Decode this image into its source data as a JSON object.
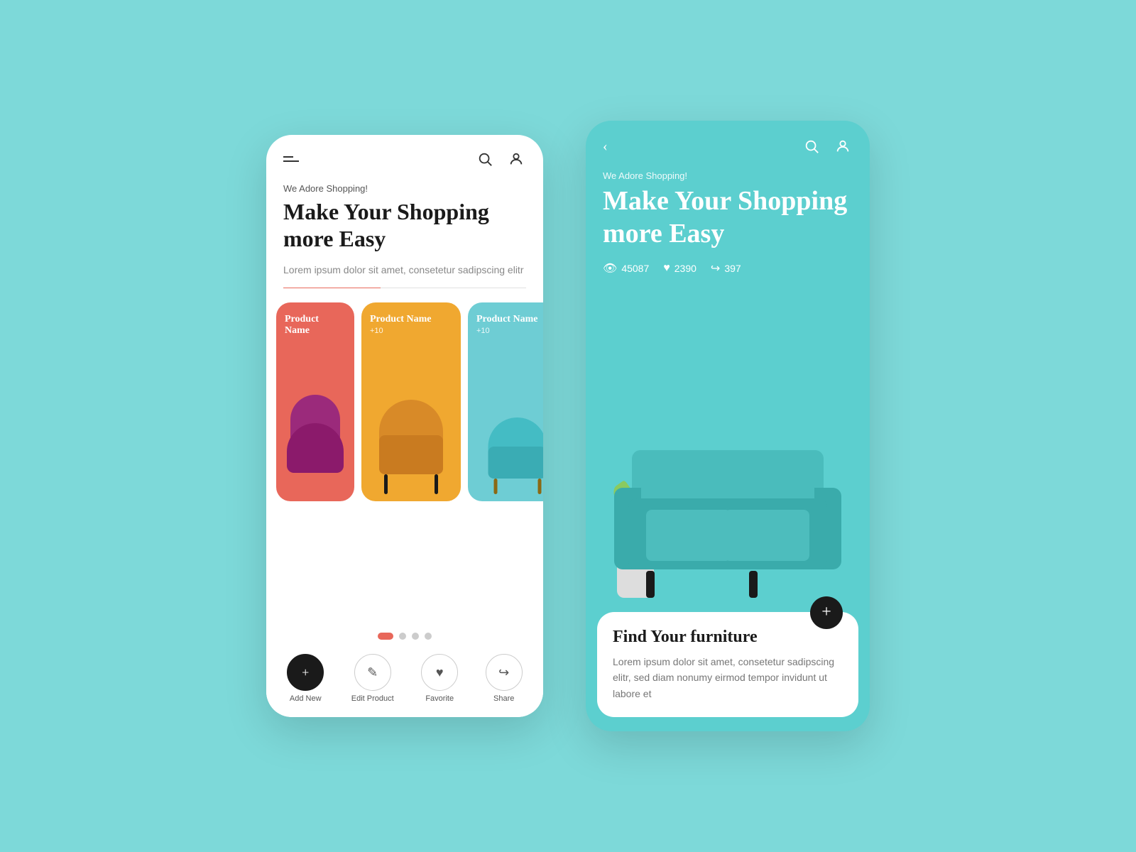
{
  "background": "#7dd9d9",
  "left_phone": {
    "sub_label": "We Adore Shopping!",
    "title": "Make Your Shopping more Easy",
    "description": "Lorem ipsum dolor sit amet, consetetur sadipscing elitr",
    "products": [
      {
        "name": "Product Name",
        "sub": "",
        "color": "pink"
      },
      {
        "name": "Product Name",
        "sub": "+10",
        "color": "orange"
      },
      {
        "name": "Product Name",
        "sub": "+10",
        "color": "teal"
      }
    ],
    "dots": [
      "active",
      "inactive",
      "inactive",
      "inactive"
    ],
    "nav_items": [
      {
        "label": "Add New",
        "icon": "+",
        "active": true
      },
      {
        "label": "Edit Product",
        "icon": "✎",
        "active": false
      },
      {
        "label": "Favorite",
        "icon": "♥",
        "active": false
      },
      {
        "label": "Share",
        "icon": "↪",
        "active": false
      }
    ]
  },
  "right_phone": {
    "sub_label": "We Adore Shopping!",
    "title": "Make Your Shopping more Easy",
    "stats": [
      {
        "icon": "👁",
        "value": "45087"
      },
      {
        "icon": "♥",
        "value": "2390"
      },
      {
        "icon": "↪",
        "value": "397"
      }
    ],
    "info_card": {
      "title": "Find Your furniture",
      "description": "Lorem ipsum dolor sit amet, consetetur sadipscing elitr, sed diam nonumy eirmod tempor invidunt ut labore et",
      "fab_label": "+"
    }
  },
  "icons": {
    "search": "search-icon",
    "user": "user-icon",
    "hamburger": "hamburger-icon",
    "back": "back-icon"
  }
}
